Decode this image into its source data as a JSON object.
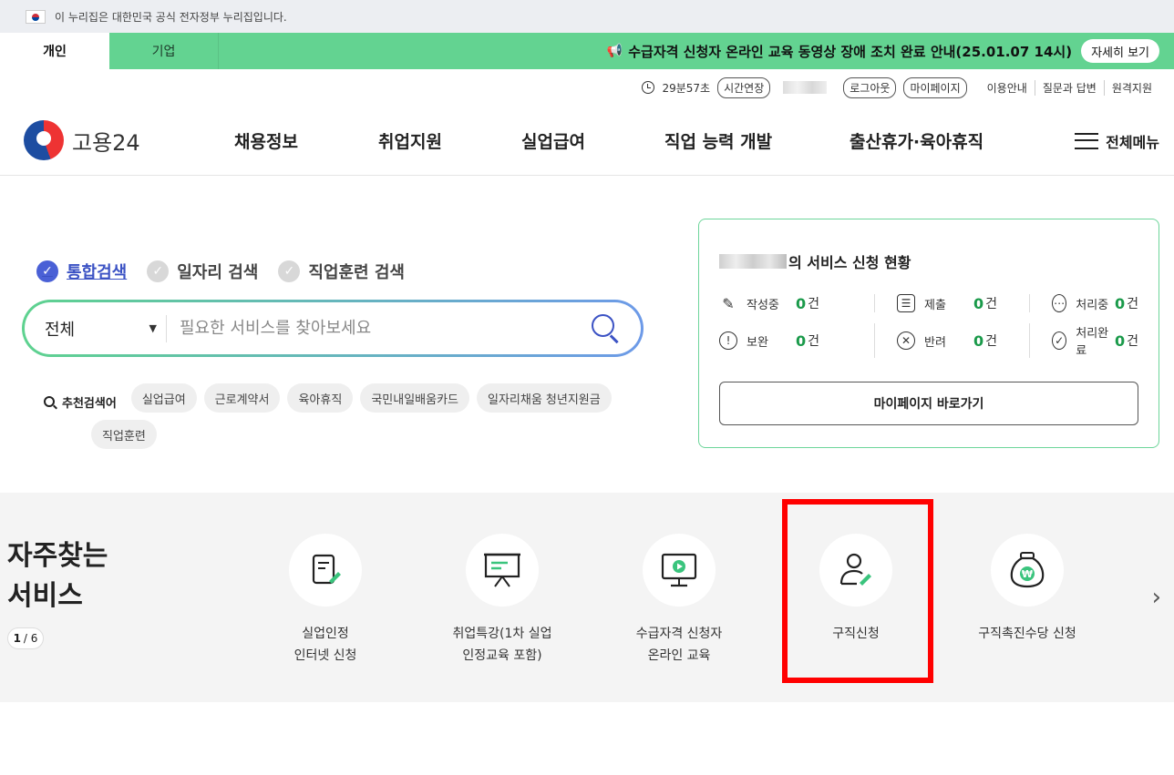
{
  "gov_banner": {
    "text": "이 누리집은 대한민국 공식 전자정부 누리집입니다."
  },
  "user_tabs": [
    {
      "label": "개인"
    },
    {
      "label": "기업"
    }
  ],
  "notice": {
    "text": "수급자격 신청자 온라인 교육 동영상 장애 조치 완료 안내(25.01.07 14시)",
    "detail_label": "자세히 보기"
  },
  "util": {
    "timer": "29분57초",
    "extend_label": "시간연장",
    "logout_label": "로그아웃",
    "mypage_label": "마이페이지",
    "links": [
      "이용안내",
      "질문과 답변",
      "원격지원"
    ]
  },
  "header": {
    "logo_text": "고용24",
    "nav": [
      "채용정보",
      "취업지원",
      "실업급여",
      "직업 능력 개발",
      "출산휴가·육아휴직"
    ],
    "all_menu_label": "전체메뉴"
  },
  "search": {
    "types": [
      "통합검색",
      "일자리 검색",
      "직업훈련 검색"
    ],
    "selected_type": "통합검색",
    "select_value": "전체",
    "placeholder": "필요한 서비스를 찾아보세요",
    "recommended_label": "추천검색어",
    "recommended": [
      "실업급여",
      "근로계약서",
      "육아휴직",
      "국민내일배움카드",
      "일자리채움 청년지원금",
      "직업훈련"
    ]
  },
  "status_card": {
    "title_suffix": "의 서비스 신청 현황",
    "items": [
      {
        "label": "작성중",
        "count": "0",
        "unit": "건",
        "icon": "pencil-icon"
      },
      {
        "label": "제출",
        "count": "0",
        "unit": "건",
        "icon": "checklist-icon"
      },
      {
        "label": "처리중",
        "count": "0",
        "unit": "건",
        "icon": "ellipsis-icon"
      },
      {
        "label": "보완",
        "count": "0",
        "unit": "건",
        "icon": "exclamation-icon"
      },
      {
        "label": "반려",
        "count": "0",
        "unit": "건",
        "icon": "x-circle-icon"
      },
      {
        "label": "처리완료",
        "count": "0",
        "unit": "건",
        "icon": "check-circle-icon"
      }
    ],
    "button_label": "마이페이지 바로가기"
  },
  "favorites": {
    "title_line1": "자주찾는",
    "title_line2": "서비스",
    "page_current": "1",
    "page_total": "/ 6",
    "services": [
      {
        "label": "실업인정\n인터넷 신청",
        "icon": "document-pen-icon"
      },
      {
        "label": "취업특강(1차 실업\n인정교육 포함)",
        "icon": "presentation-board-icon"
      },
      {
        "label": "수급자격 신청자\n온라인 교육",
        "icon": "monitor-play-icon"
      },
      {
        "label": "구직신청",
        "icon": "person-pen-icon"
      },
      {
        "label": "구직촉진수당 신청",
        "icon": "money-bag-icon"
      }
    ]
  },
  "colors": {
    "brand_green": "#63d391",
    "accent_blue": "#3b52c4",
    "highlight_red": "#ff0000",
    "count_green": "#1a9a4a"
  }
}
